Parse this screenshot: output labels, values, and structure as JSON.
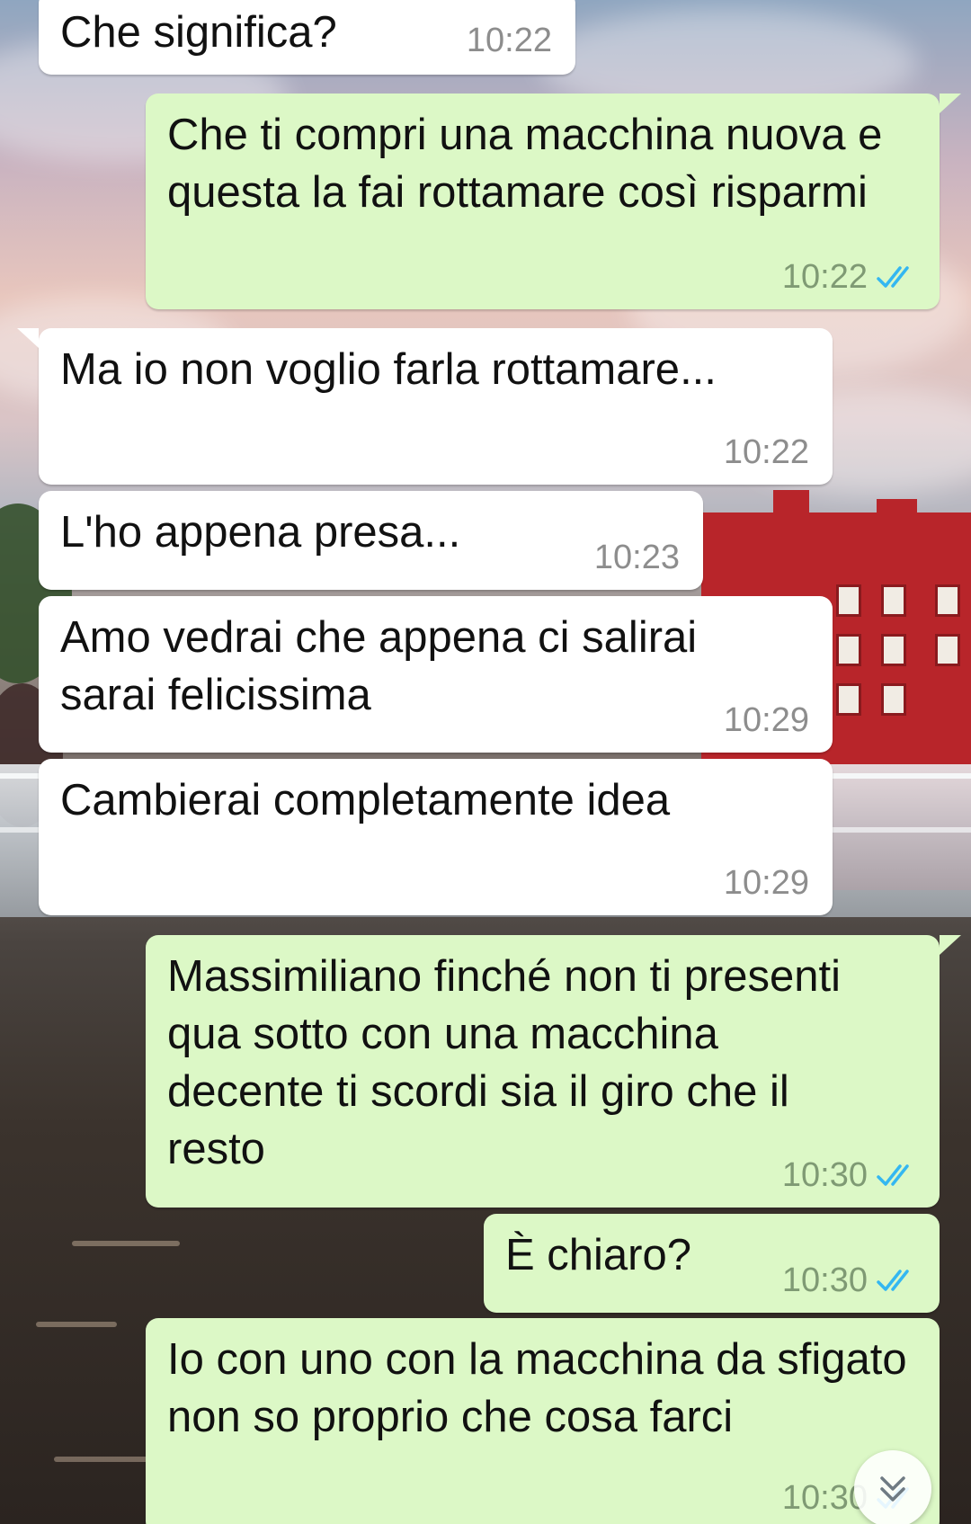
{
  "messages": [
    {
      "direction": "incoming",
      "text": "Che significa?",
      "time": "10:22"
    },
    {
      "direction": "outgoing",
      "text": "Che ti compri una macchina nuova e questa la fai rottamare così risparmi",
      "time": "10:22",
      "status": "read"
    },
    {
      "direction": "incoming",
      "text": "Ma io non voglio farla rottamare...",
      "time": "10:22"
    },
    {
      "direction": "incoming",
      "text": "L'ho appena presa...",
      "time": "10:23"
    },
    {
      "direction": "incoming",
      "text": "Amo vedrai che appena ci salirai sarai felicissima",
      "time": "10:29"
    },
    {
      "direction": "incoming",
      "text": "Cambierai completamente idea",
      "time": "10:29"
    },
    {
      "direction": "outgoing",
      "text": "Massimiliano finché non ti presenti qua sotto con una macchina decente ti scordi sia il giro che il resto",
      "time": "10:30",
      "status": "read"
    },
    {
      "direction": "outgoing",
      "text": "È chiaro?",
      "time": "10:30",
      "status": "read"
    },
    {
      "direction": "outgoing",
      "text": "Io con uno con la macchina da sfigato non so proprio che cosa farci",
      "time": "10:30",
      "status": "read"
    }
  ],
  "colors": {
    "incoming_bubble": "#ffffff",
    "outgoing_bubble": "#dcf8c6",
    "read_ticks": "#34b7f1",
    "timestamp": "#8d8d8d"
  },
  "icons": {
    "read_status": "double-check-icon",
    "scroll_down": "chevron-double-down-icon"
  }
}
